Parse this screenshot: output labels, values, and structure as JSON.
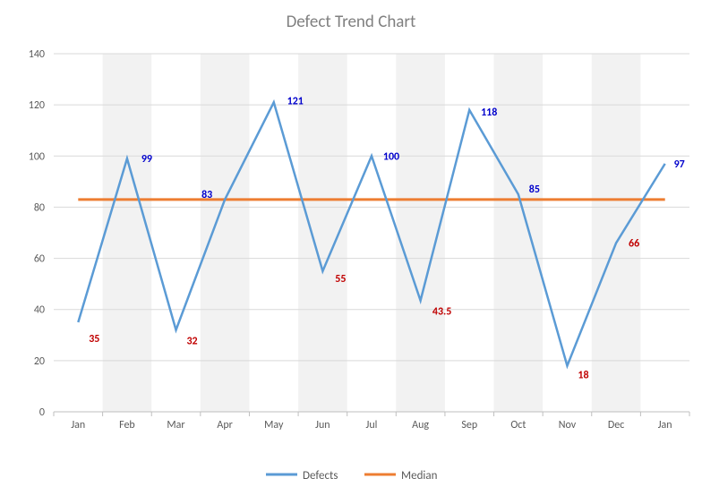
{
  "chart_data": {
    "type": "line",
    "title": "Defect Trend Chart",
    "categories": [
      "Jan",
      "Feb",
      "Mar",
      "Apr",
      "May",
      "Jun",
      "Jul",
      "Aug",
      "Sep",
      "Oct",
      "Nov",
      "Dec",
      "Jan"
    ],
    "series": [
      {
        "name": "Defects",
        "color": "#5b9bd5",
        "values": [
          35,
          99,
          32,
          83,
          121,
          55,
          100,
          43.5,
          118,
          85,
          18,
          66,
          97
        ]
      },
      {
        "name": "Median",
        "color": "#ed7d31",
        "values": [
          83,
          83,
          83,
          83,
          83,
          83,
          83,
          83,
          83,
          83,
          83,
          83,
          83
        ]
      }
    ],
    "ylim": [
      0,
      140
    ],
    "yticks": [
      0,
      20,
      40,
      60,
      80,
      100,
      120,
      140
    ],
    "xlabel": "",
    "ylabel": "",
    "legend_position": "bottom",
    "median_value": 83,
    "data_labels_above_color": "#0000cc",
    "data_labels_below_color": "#c00000"
  },
  "legend": {
    "defects": "Defects",
    "median": "Median"
  }
}
